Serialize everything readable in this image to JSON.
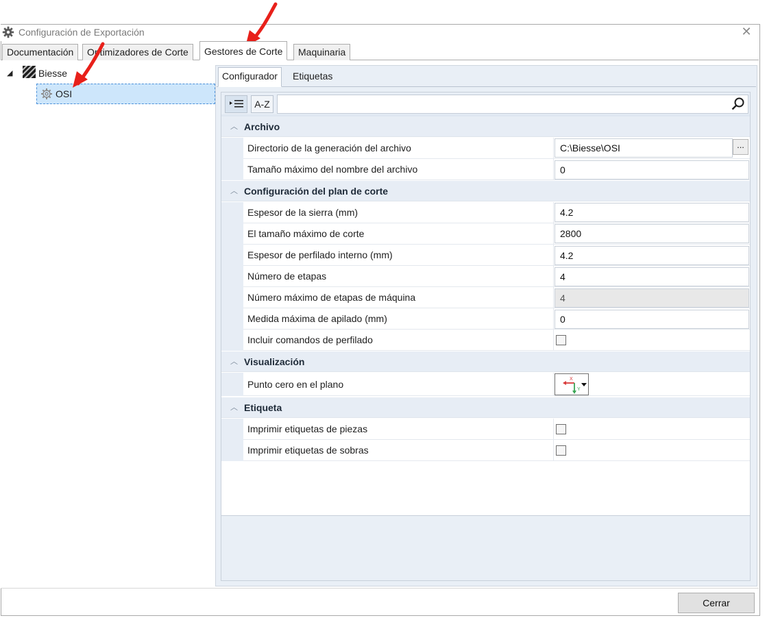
{
  "window": {
    "title": "Configuración de Exportación"
  },
  "main_tabs": [
    "Documentación",
    "Optimizadores de Corte",
    "Gestores de Corte",
    "Maquinaria"
  ],
  "tree": {
    "root": "Biesse",
    "child": "OSI"
  },
  "sub_tabs": [
    "Configurador",
    "Etiquetas"
  ],
  "toolbar": {
    "categorized_label": "",
    "az_label": "A-Z",
    "search_placeholder": ""
  },
  "categories": {
    "archivo": "Archivo",
    "plan": "Configuración del plan de corte",
    "visualizacion": "Visualización",
    "etiqueta": "Etiqueta"
  },
  "properties": {
    "directorio": {
      "label": "Directorio de la generación del archivo",
      "value": "C:\\Biesse\\OSI",
      "browse": "..."
    },
    "tamano_nombre": {
      "label": "Tamaño máximo del nombre del archivo",
      "value": "0"
    },
    "espesor_sierra": {
      "label": "Espesor de la sierra (mm)",
      "value": "4.2"
    },
    "tamano_corte": {
      "label": "El tamaño máximo de corte",
      "value": "2800"
    },
    "espesor_perfilado": {
      "label": "Espesor de perfilado interno (mm)",
      "value": "4.2"
    },
    "num_etapas": {
      "label": "Número de etapas",
      "value": "4"
    },
    "num_max_etapas": {
      "label": "Número máximo de etapas de máquina",
      "value": "4"
    },
    "medida_apilado": {
      "label": "Medida máxima de apilado (mm)",
      "value": "0"
    },
    "incluir_comandos": {
      "label": "Incluir comandos de perfilado",
      "checked": false
    },
    "punto_cero": {
      "label": "Punto cero en el plano",
      "x_label": "X",
      "y_label": "Y"
    },
    "imprimir_piezas": {
      "label": "Imprimir etiquetas de piezas",
      "checked": false
    },
    "imprimir_sobras": {
      "label": "Imprimir etiquetas de sobras",
      "checked": false
    }
  },
  "buttons": {
    "close": "Cerrar"
  },
  "colors": {
    "selection": "#cde6fb",
    "arrow": "#e8201a",
    "category_bg": "#e7edf5"
  }
}
